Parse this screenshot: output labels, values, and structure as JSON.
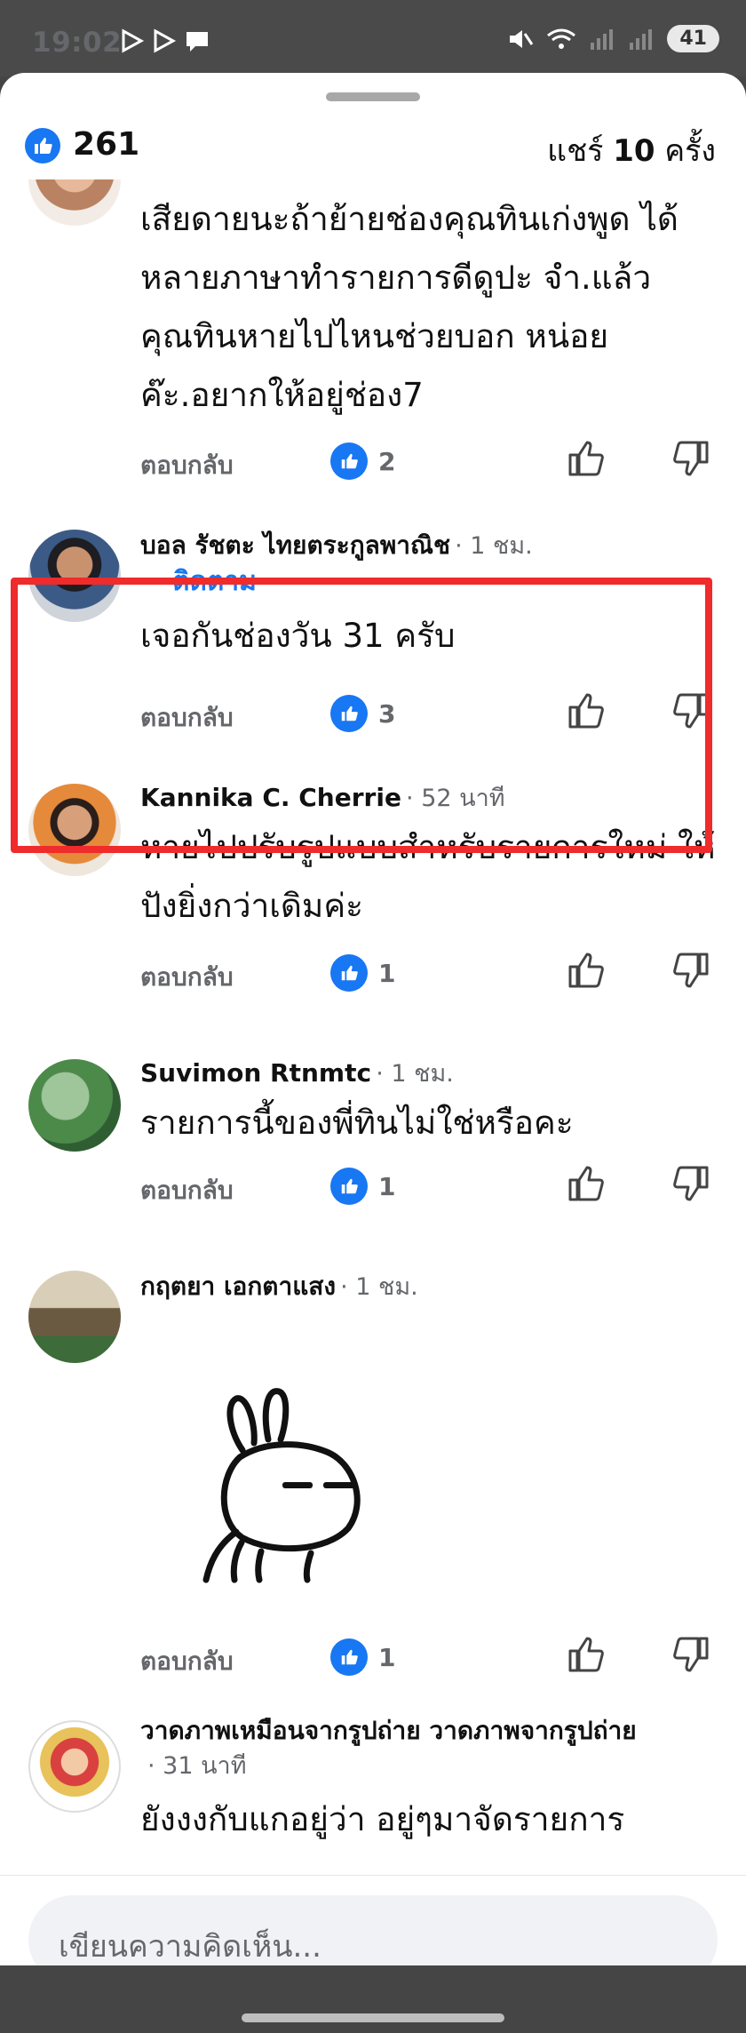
{
  "status_bar": {
    "time": "19:02",
    "battery": "41"
  },
  "header": {
    "like_count": "261",
    "share_prefix": "แชร์",
    "share_count": "10",
    "share_suffix": "ครั้ง"
  },
  "comments": [
    {
      "name": "",
      "time": "",
      "text": "เสียดายนะถ้าย้ายช่องคุณทินเก่งพูด ได้หลายภาษาทำรายการดีดูปะ จำ.แล้วคุณทินหายไปไหนช่วยบอก หน่อยค๊ะ.อยากให้อยู่ช่อง7",
      "reply": "ตอบกลับ",
      "reactions": "2"
    },
    {
      "name": "บอล รัชตะ ไทยตระกูลพาณิช",
      "time": "· 1 ชม.",
      "follow": "· ติดตาม",
      "text": "เจอกันช่องวัน 31 ครับ",
      "reply": "ตอบกลับ",
      "reactions": "3"
    },
    {
      "name": "Kannika C. Cherrie",
      "time": "· 52 นาที",
      "text": "หายไปปรับรูปแบบสำหรับรายการใหม่ ให้ปังยิ่งกว่าเดิมค่ะ",
      "reply": "ตอบกลับ",
      "reactions": "1"
    },
    {
      "name": "Suvimon Rtnmtc",
      "time": "· 1 ชม.",
      "text": "รายการนี้ของพี่ทินไม่ใช่หรือคะ",
      "reply": "ตอบกลับ",
      "reactions": "1"
    },
    {
      "name": "กฤตยา เอกตาแสง",
      "time": "· 1 ชม.",
      "text": "",
      "sticker": "rabbit-sticker",
      "reply": "ตอบกลับ",
      "reactions": "1"
    },
    {
      "name": "วาดภาพเหมือนจากรูปถ่าย วาดภาพจากรูปถ่าย",
      "time": "· 31 นาที",
      "text": "ยังงงกับแกอยู่ว่า อยู่ๆมาจัดรายการ"
    }
  ],
  "composer": {
    "placeholder": "เขียนความคิดเห็น..."
  },
  "colors": {
    "accent": "#1877f2",
    "highlight": "#ef2b2b"
  }
}
